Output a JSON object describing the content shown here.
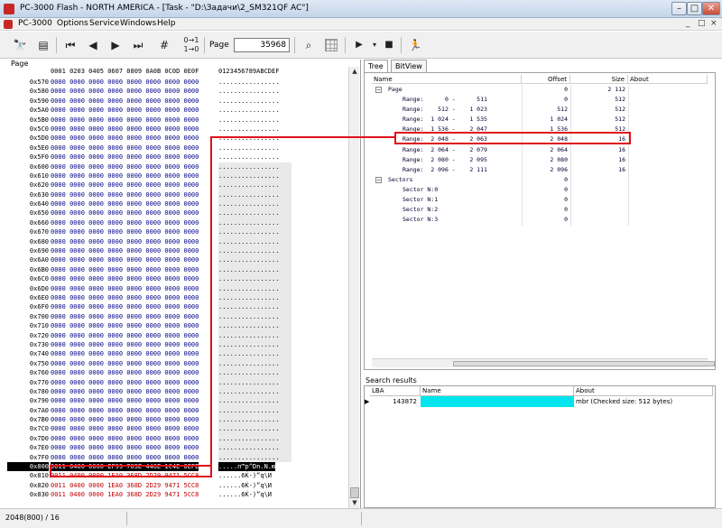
{
  "window": {
    "title": "PC-3000 Flash - NORTH AMERICA - [Task - \"D:\\Задачи\\2_SM321QF AC\"]",
    "min_glyph": "–",
    "max_glyph": "□",
    "close_glyph": "✕"
  },
  "menu": {
    "items": [
      "PC-3000",
      "Options",
      "Service",
      "Windows",
      "Help"
    ],
    "mdi": [
      "_",
      "□",
      "×"
    ]
  },
  "toolbar": {
    "page_label": "Page",
    "page_value": "35968",
    "icons": [
      "binoculars-icon",
      "find-pages-icon",
      "first-page-icon",
      "prev-page-icon",
      "next-page-icon",
      "last-page-icon",
      "goto-number-icon",
      "swap-bits-icon",
      "search-icon",
      "grid-icon",
      "play-icon",
      "dropdown-icon",
      "stop-icon",
      "runner-icon"
    ]
  },
  "hex": {
    "caption": "Page",
    "header_offsets": "0001 0203 0405 0607 0809 0A0B 0C0D 0E0F",
    "header_ascii": "0123456789ABCDEF",
    "rows": [
      {
        "addr": "0x570",
        "bytes": "0000 0000 0000 0000 0000 0000 0000 0000",
        "ascii": "................"
      },
      {
        "addr": "0x580",
        "bytes": "0000 0000 0000 0000 0000 0000 0000 0000",
        "ascii": "................"
      },
      {
        "addr": "0x590",
        "bytes": "0000 0000 0000 0000 0000 0000 0000 0000",
        "ascii": "................"
      },
      {
        "addr": "0x5A0",
        "bytes": "0000 0000 0000 0000 0000 0000 0000 0000",
        "ascii": "................"
      },
      {
        "addr": "0x5B0",
        "bytes": "0000 0000 0000 0000 0000 0000 0000 0000",
        "ascii": "................"
      },
      {
        "addr": "0x5C0",
        "bytes": "0000 0000 0000 0000 0000 0000 0000 0000",
        "ascii": "................"
      },
      {
        "addr": "0x5D0",
        "bytes": "0000 0000 0000 0000 0000 0000 0000 0000",
        "ascii": "................"
      },
      {
        "addr": "0x5E0",
        "bytes": "0000 0000 0000 0000 0000 0000 0000 0000",
        "ascii": "................"
      },
      {
        "addr": "0x5F0",
        "bytes": "0000 0000 0000 0000 0000 0000 0000 0000",
        "ascii": "................"
      },
      {
        "addr": "0x600",
        "bytes": "0000 0000 0000 0000 0000 0000 0000 0000",
        "ascii": "................"
      },
      {
        "addr": "0x610",
        "bytes": "0000 0000 0000 0000 0000 0000 0000 0000",
        "ascii": "................"
      },
      {
        "addr": "0x620",
        "bytes": "0000 0000 0000 0000 0000 0000 0000 0000",
        "ascii": "................"
      },
      {
        "addr": "0x630",
        "bytes": "0000 0000 0000 0000 0000 0000 0000 0000",
        "ascii": "................"
      },
      {
        "addr": "0x640",
        "bytes": "0000 0000 0000 0000 0000 0000 0000 0000",
        "ascii": "................"
      },
      {
        "addr": "0x650",
        "bytes": "0000 0000 0000 0000 0000 0000 0000 0000",
        "ascii": "................"
      },
      {
        "addr": "0x660",
        "bytes": "0000 0000 0000 0000 0000 0000 0000 0000",
        "ascii": "................"
      },
      {
        "addr": "0x670",
        "bytes": "0000 0000 0000 0000 0000 0000 0000 0000",
        "ascii": "................"
      },
      {
        "addr": "0x680",
        "bytes": "0000 0000 0000 0000 0000 0000 0000 0000",
        "ascii": "................"
      },
      {
        "addr": "0x690",
        "bytes": "0000 0000 0000 0000 0000 0000 0000 0000",
        "ascii": "................"
      },
      {
        "addr": "0x6A0",
        "bytes": "0000 0000 0000 0000 0000 0000 0000 0000",
        "ascii": "................"
      },
      {
        "addr": "0x6B0",
        "bytes": "0000 0000 0000 0000 0000 0000 0000 0000",
        "ascii": "................"
      },
      {
        "addr": "0x6C0",
        "bytes": "0000 0000 0000 0000 0000 0000 0000 0000",
        "ascii": "................"
      },
      {
        "addr": "0x6D0",
        "bytes": "0000 0000 0000 0000 0000 0000 0000 0000",
        "ascii": "................"
      },
      {
        "addr": "0x6E0",
        "bytes": "0000 0000 0000 0000 0000 0000 0000 0000",
        "ascii": "................"
      },
      {
        "addr": "0x6F0",
        "bytes": "0000 0000 0000 0000 0000 0000 0000 0000",
        "ascii": "................"
      },
      {
        "addr": "0x700",
        "bytes": "0000 0000 0000 0000 0000 0000 0000 0000",
        "ascii": "................"
      },
      {
        "addr": "0x710",
        "bytes": "0000 0000 0000 0000 0000 0000 0000 0000",
        "ascii": "................"
      },
      {
        "addr": "0x720",
        "bytes": "0000 0000 0000 0000 0000 0000 0000 0000",
        "ascii": "................"
      },
      {
        "addr": "0x730",
        "bytes": "0000 0000 0000 0000 0000 0000 0000 0000",
        "ascii": "................"
      },
      {
        "addr": "0x740",
        "bytes": "0000 0000 0000 0000 0000 0000 0000 0000",
        "ascii": "................"
      },
      {
        "addr": "0x750",
        "bytes": "0000 0000 0000 0000 0000 0000 0000 0000",
        "ascii": "................"
      },
      {
        "addr": "0x760",
        "bytes": "0000 0000 0000 0000 0000 0000 0000 0000",
        "ascii": "................"
      },
      {
        "addr": "0x770",
        "bytes": "0000 0000 0000 0000 0000 0000 0000 0000",
        "ascii": "................"
      },
      {
        "addr": "0x780",
        "bytes": "0000 0000 0000 0000 0000 0000 0000 0000",
        "ascii": "................"
      },
      {
        "addr": "0x790",
        "bytes": "0000 0000 0000 0000 0000 0000 0000 0000",
        "ascii": "................"
      },
      {
        "addr": "0x7A0",
        "bytes": "0000 0000 0000 0000 0000 0000 0000 0000",
        "ascii": "................"
      },
      {
        "addr": "0x7B0",
        "bytes": "0000 0000 0000 0000 0000 0000 0000 0000",
        "ascii": "................"
      },
      {
        "addr": "0x7C0",
        "bytes": "0000 0000 0000 0000 0000 0000 0000 0000",
        "ascii": "................"
      },
      {
        "addr": "0x7D0",
        "bytes": "0000 0000 0000 0000 0000 0000 0000 0000",
        "ascii": "................"
      },
      {
        "addr": "0x7E0",
        "bytes": "0000 0000 0000 0000 0000 0000 0000 0000",
        "ascii": "................"
      },
      {
        "addr": "0x7F0",
        "bytes": "0000 0000 0000 0000 0000 0000 0000 0000",
        "ascii": "................"
      },
      {
        "addr": "0x800",
        "bytes": "0011 0400 0000 EF99 705E 446E 1C4E 0EFE",
        "ascii": ".....п™p^Dn.N.ю",
        "selected": true
      },
      {
        "addr": "0x810",
        "bytes": "0011 0400 0000 1EA0 368D 2D29 9471 5CC8",
        "ascii": "......6Ќ-)”q\\И",
        "red": true
      },
      {
        "addr": "0x820",
        "bytes": "0011 0400 0000 1EA0 368D 2D29 9471 5CC8",
        "ascii": "......6Ќ-)”q\\И",
        "red": true
      },
      {
        "addr": "0x830",
        "bytes": "0011 0400 0000 1EA0 368D 2D29 9471 5CC8",
        "ascii": "......6Ќ-)”q\\И",
        "red": true
      }
    ]
  },
  "tree": {
    "tabs": [
      "Tree",
      "BitView"
    ],
    "columns": [
      "Name",
      "Offset",
      "Size",
      "About"
    ],
    "rows": [
      {
        "name": "Page",
        "offset": "0",
        "size": "2 112",
        "level": 0,
        "expander": "−"
      },
      {
        "name": "Range:      0 -      511",
        "offset": "0",
        "size": "512",
        "level": 1
      },
      {
        "name": "Range:    512 -    1 023",
        "offset": "512",
        "size": "512",
        "level": 1
      },
      {
        "name": "Range:  1 024 -    1 535",
        "offset": "1 024",
        "size": "512",
        "level": 1
      },
      {
        "name": "Range:  1 536 -    2 047",
        "offset": "1 536",
        "size": "512",
        "level": 1
      },
      {
        "name": "Range:  2 048 -    2 063",
        "offset": "2 048",
        "size": "16",
        "level": 1,
        "boxed": true
      },
      {
        "name": "Range:  2 064 -    2 079",
        "offset": "2 064",
        "size": "16",
        "level": 1
      },
      {
        "name": "Range:  2 080 -    2 095",
        "offset": "2 080",
        "size": "16",
        "level": 1
      },
      {
        "name": "Range:  2 096 -    2 111",
        "offset": "2 096",
        "size": "16",
        "level": 1
      },
      {
        "name": "Sectors",
        "offset": "0",
        "size": "",
        "level": 0,
        "expander": "−"
      },
      {
        "name": "Sector N:0",
        "offset": "0",
        "size": "",
        "level": 1
      },
      {
        "name": "Sector N:1",
        "offset": "0",
        "size": "",
        "level": 1
      },
      {
        "name": "Sector N:2",
        "offset": "0",
        "size": "",
        "level": 1
      },
      {
        "name": "Sector N:3",
        "offset": "0",
        "size": "",
        "level": 1
      }
    ]
  },
  "search": {
    "caption": "Search results",
    "columns": [
      "LBA",
      "Name",
      "About"
    ],
    "row": {
      "indicator": "▶",
      "lba": "143872",
      "name": "",
      "about": "mbr (Checked size: 512 bytes)"
    },
    "name_cell_color": "#00e5ee"
  },
  "status": {
    "text": "2048(800) / 16"
  },
  "colors": {
    "annotation": "#e0101a",
    "hex_bytes": "#00008b",
    "hex_red_bytes": "#c00000"
  }
}
